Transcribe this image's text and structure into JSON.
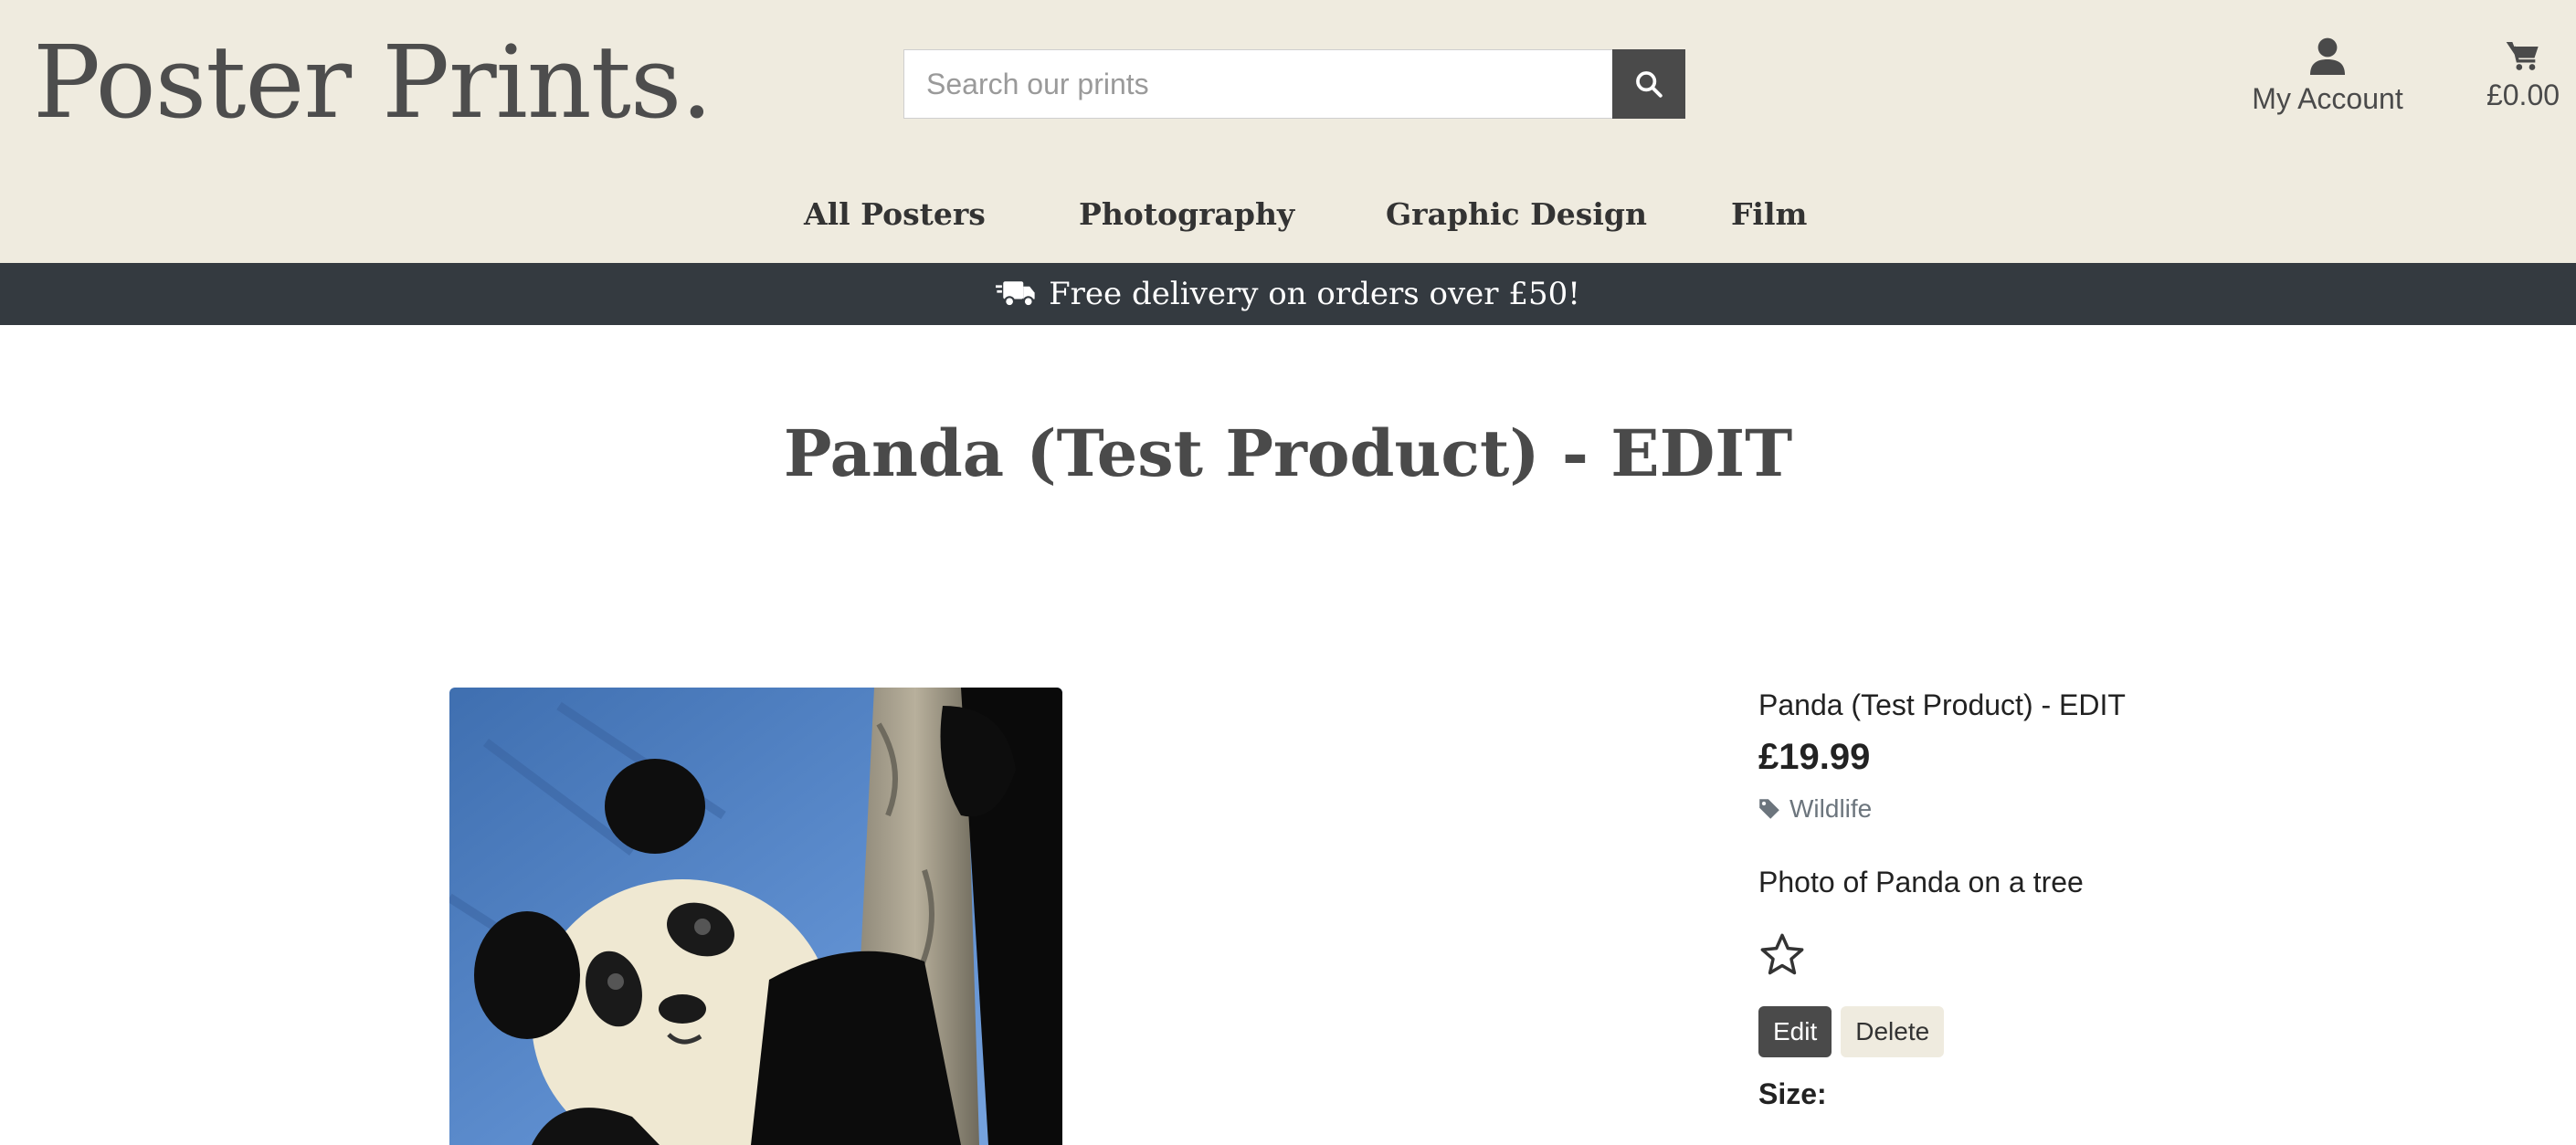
{
  "header": {
    "logo": "Poster Prints.",
    "search": {
      "placeholder": "Search our prints",
      "value": "",
      "button_icon": "search-icon"
    },
    "account": {
      "label": "My Account",
      "icon": "user-icon"
    },
    "cart": {
      "total": "£0.00",
      "icon": "cart-icon"
    }
  },
  "nav": {
    "items": [
      {
        "label": "All Posters"
      },
      {
        "label": "Photography"
      },
      {
        "label": "Graphic Design"
      },
      {
        "label": "Film"
      }
    ]
  },
  "banner": {
    "text": "Free delivery on orders over £50!",
    "icon": "delivery-truck-icon"
  },
  "page": {
    "title": "Panda (Test Product) - EDIT"
  },
  "product": {
    "name": "Panda (Test Product) - EDIT",
    "price": "£19.99",
    "category": "Wildlife",
    "category_icon": "tag-icon",
    "description": "Photo of Panda on a tree",
    "favourite_icon": "star-icon",
    "edit_label": "Edit",
    "delete_label": "Delete",
    "size_label": "Size:"
  },
  "colors": {
    "header_bg": "#efebdf",
    "banner_bg": "#343a40",
    "dark_button": "#4a4a4a",
    "light_button": "#efebdf",
    "muted_text": "#6c757d"
  }
}
